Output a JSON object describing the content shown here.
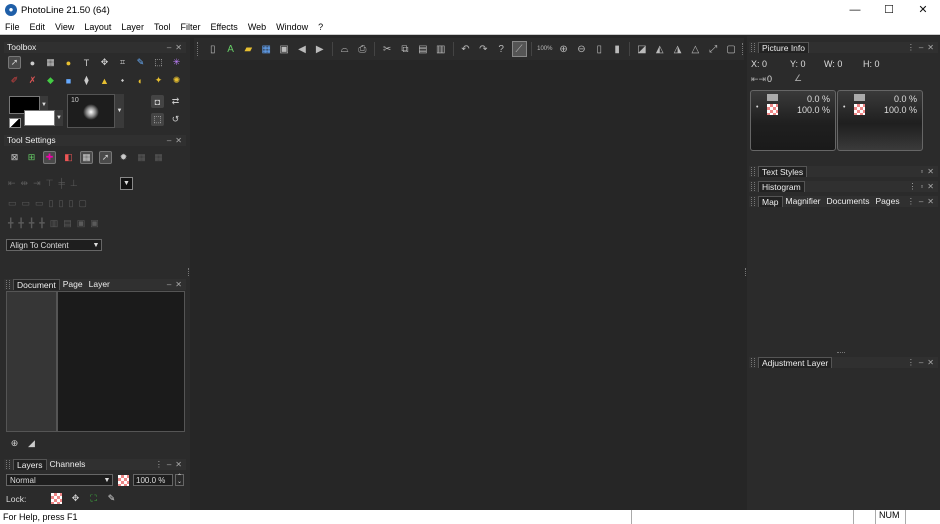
{
  "window": {
    "title": "PhotoLine 21.50 (64)",
    "controls": {
      "minimize": "—",
      "maximize": "☐",
      "close": "✕"
    }
  },
  "menu": [
    "File",
    "Edit",
    "View",
    "Layout",
    "Layer",
    "Tool",
    "Filter",
    "Effects",
    "Web",
    "Window",
    "?"
  ],
  "toolbar": {
    "zoom_label": "100%"
  },
  "panels": {
    "toolbox": {
      "title": "Toolbox",
      "brush_size": "10"
    },
    "tool_settings": {
      "title": "Tool Settings",
      "align_mode": "Align To Content"
    },
    "document_panel": {
      "tabs": [
        "Document",
        "Page",
        "Layer"
      ]
    },
    "layers_panel": {
      "tabs": [
        "Layers",
        "Channels"
      ],
      "blend_mode": "Normal",
      "opacity": "100.0 %",
      "lock_label": "Lock:"
    },
    "picture_info": {
      "title": "Picture Info",
      "x": "X: 0",
      "y": "Y: 0",
      "w": "W: 0",
      "h": "H: 0",
      "distance": "0",
      "left_pct_top": "0.0 %",
      "left_pct_bottom": "100.0 %",
      "right_pct_top": "0.0 %",
      "right_pct_bottom": "100.0 %"
    },
    "text_styles": {
      "title": "Text Styles"
    },
    "histogram": {
      "title": "Histogram"
    },
    "map_panel": {
      "tabs": [
        "Map",
        "Magnifier",
        "Documents",
        "Pages"
      ]
    },
    "adjustment_layer": {
      "title": "Adjustment Layer"
    }
  },
  "status": {
    "help": "For Help, press F1",
    "num": "NUM"
  }
}
